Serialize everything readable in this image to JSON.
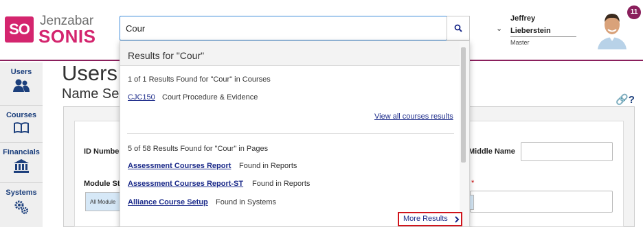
{
  "brand": {
    "logo_mark": "SO",
    "company": "Jenzabar",
    "product": "SONIS",
    "accent": "#d4256e"
  },
  "search": {
    "value": "Cour",
    "button_icon": "search-icon"
  },
  "user": {
    "first_name": "Jeffrey",
    "last_name": "Lieberstein",
    "role": "Master",
    "notifications": "11"
  },
  "sidebar": {
    "items": [
      {
        "label": "Users",
        "icon": "users-icon"
      },
      {
        "label": "Courses",
        "icon": "book-icon"
      },
      {
        "label": "Financials",
        "icon": "bank-icon"
      },
      {
        "label": "Systems",
        "icon": "gears-icon"
      }
    ]
  },
  "page": {
    "title": "Users",
    "subtitle": "Name Se"
  },
  "form": {
    "id_label": "ID Numbe",
    "middle_name_label": "Middle Name",
    "module_label": "Module St",
    "module_chip": "All Module",
    "required_mark": "*"
  },
  "results": {
    "header": "Results for \"Cour\"",
    "courses_summary": "1 of 1 Results Found for \"Cour\" in Courses",
    "course": {
      "code": "CJC150",
      "name": "Court Procedure & Evidence"
    },
    "view_all": "View all courses results",
    "pages_summary": "5 of 58 Results Found for \"Cour\" in Pages",
    "pages": [
      {
        "title": "Assessment Courses Report",
        "location": "Found in Reports"
      },
      {
        "title": "Assessment Courses Report-ST",
        "location": "Found in Reports"
      },
      {
        "title": "Alliance Course Setup",
        "location": "Found in Systems"
      }
    ],
    "more": "More Results"
  }
}
